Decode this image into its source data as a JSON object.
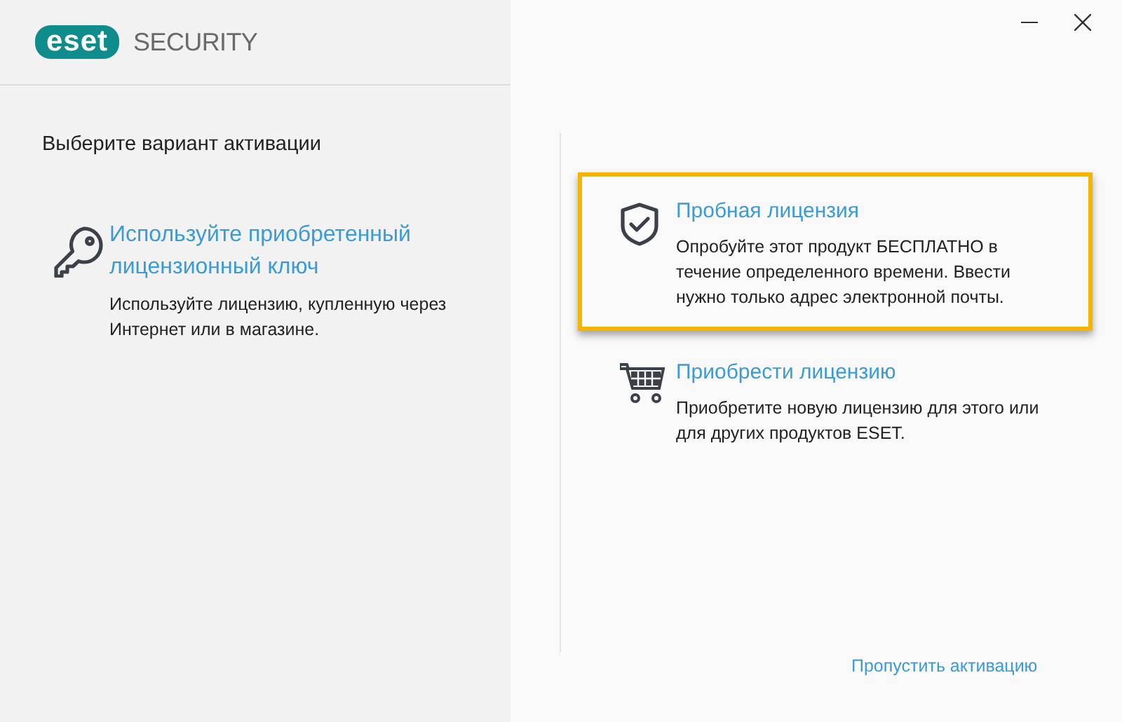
{
  "window": {
    "logo": "eset",
    "product": "SECURITY"
  },
  "heading": "Выберите вариант активации",
  "left_options": [
    {
      "kind": "key",
      "title": "Используйте приобретенный лицензионный ключ",
      "description": "Используйте лицензию, купленную через Интернет или в магазине.",
      "selected": false
    }
  ],
  "right_options": [
    {
      "kind": "shield",
      "title": "Пробная лицензия",
      "description": "Опробуйте этот продукт БЕСПЛАТНО в течение определенного времени. Ввести нужно только адрес электронной почты.",
      "selected": true
    },
    {
      "kind": "cart",
      "title": "Приобрести лицензию",
      "description": "Приобретите новую лицензию для этого или для других продуктов ESET.",
      "selected": false
    }
  ],
  "skip_link": "Пропустить активацию"
}
